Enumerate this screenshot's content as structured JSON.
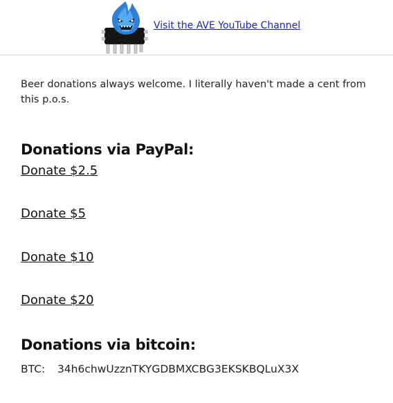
{
  "header": {
    "logo_icon": "ave-chip-mascot-icon",
    "youtube_link": " Visit the AVE YouTube Channel",
    "link_color": "#1f1fc8"
  },
  "intro": {
    "text": "Beer donations always welcome. I literally haven't made a cent from this p.o.s."
  },
  "paypal": {
    "heading": "Donations via PayPal:",
    "links": [
      {
        "label": "Donate $2.5"
      },
      {
        "label": "Donate $5"
      },
      {
        "label": "Donate $10"
      },
      {
        "label": "Donate $20"
      }
    ]
  },
  "bitcoin": {
    "heading": "Donations via bitcoin:",
    "label": "BTC:",
    "address": "34h6chwUzznTKYGDBMXCBG3EKSKBQLuX3X"
  }
}
